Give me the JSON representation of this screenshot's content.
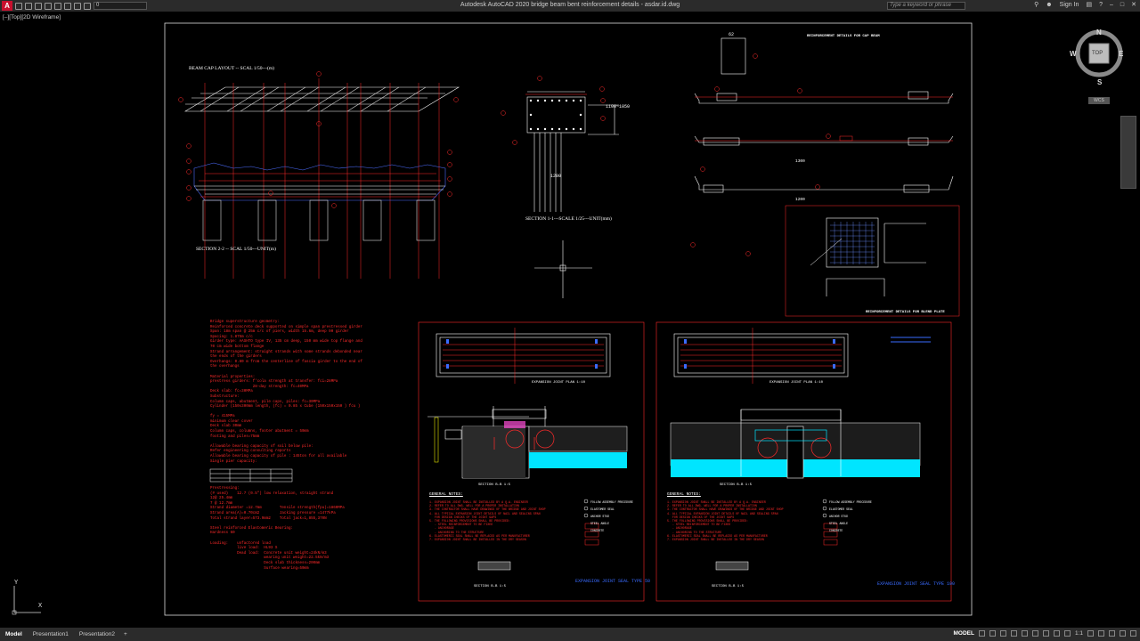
{
  "app": {
    "title": "Autodesk AutoCAD 2020   bridge beam bent reinforcement details - asdar.id.dwg",
    "layer_value": "0",
    "search_placeholder": "Type a keyword or phrase",
    "sign_in": "Sign In",
    "viewport_label": "[–][Top][2D Wireframe]"
  },
  "viewcube": {
    "north": "N",
    "south": "S",
    "east": "E",
    "west": "W",
    "face": "TOP",
    "wcs": "WCS"
  },
  "ucs": {
    "x_label": "X",
    "y_label": "Y"
  },
  "drawing": {
    "beam_cap_title": "BEAM CAP LAYOUT -- SCAL 1/50---(m)",
    "section22_title": "SECTION 2-2 -- SCAL 1/50---UNIT(m)",
    "section11_title": "SECTION 1-1---SCALE 1/25---UNIT(mm)",
    "section11_dim1": "1100~1050",
    "section11_dim2": "1200",
    "reinf_title_top": "REINFORCEMENT DETAILS FOR CAP BEAM",
    "reinf_title_bottom": "REINFORCEMENT DETAILS FOR BLEND PLATE",
    "top_dim": "62",
    "notes_left": [
      "Bridge superstructure geometry:",
      "Reinforced concrete deck supported on simple span prestressed girder",
      "Span: 18m span @ 25m c/c of piers, width 15.6m, deep 90 girder",
      "Spacing: 1.875m c/c",
      "Girder type: AASHTO type IV, 135 cm deep, 150 mm wide top flange and",
      "70 cm wide bottom flange",
      "Strand arrangement: straight strands with some strands debonded near",
      "the ends of the girders",
      "Overhangs: 0.80 m from the centerline of fascia girder to the end of",
      "the overhangs",
      "",
      "Material properties:",
      "prestress girders: f'cola strength at transfer: fci=28MPa",
      "                   28-day strength: fc=40MPa",
      "Deck slab: fc=30MPa",
      "Substructure:",
      "Column caps, abutment, pile caps, piles: fc=30MPa",
      "Cylinder (150x300mm length, (fc) = 0.85 x Cube (150x150x150 ) fcu )",
      "",
      "fy = 415MPa",
      "minimum clear cover",
      "Deck slab 30mm",
      "Column caps, columns, footer abutment = 50mm",
      "footing and piles=75mm",
      "",
      "Allowable bearing capacity of soil below pile:",
      "Refer engineering consulting reports",
      "Allowable bearing capacity of pile : 145ton for all available",
      "Single pier capacity:"
    ],
    "notes_left_2": [
      "Prestressing:",
      "(# used)    12.7 (0.5\") low relaxation, straight strand",
      "12@ 25.4mm",
      "7 @ 12.7mm",
      "Strand diameter =12.7mm        Tensile strength(fpu)=1860MPa",
      "Strand area(A)=0.70cm2         Jacking pressure =1477kPa",
      "Total strand layer=573.9mm2    Total jack=1,855,370N",
      "",
      "Steel reinforced Elastomeric Bearing:",
      "Hardness 60",
      "",
      "Loading:    unfactored load",
      "            live load:  HL93 S",
      "            Dead load:  Concrete unit weight=24kN/m3",
      "                        wearing unit weight=22.5kN/m3",
      "                        Deck slab thickness=200mm",
      "                        Surface wearing=50mm"
    ],
    "exp_plan_label": "EXPANSION JOINT PLAN  1:10",
    "section_label": "SECTION B-B  1:5",
    "general_notes": "GENERAL NOTES:",
    "gn_lines": [
      "1. EXPANSION JOINT SHALL BE INSTALLED BY A Q.A. ENGINEER",
      "2. REFER TO ALL DWG. WELL FOR A PROPER INSTALLATION",
      "3. THE CONTRACTOR SHALL HAVE DRAWINGS OF THE BRIDGE AND JOINT SHOP",
      "4. ALL TYPICAL EXPANSION JOINT DETAILS OF NAIL AND SEALING SPAN",
      "   FOR DESIGN CHECKS OF THE JOINT GAPS",
      "5. THE FOLLOWING PROVISIONS SHALL BE PROVIDED:",
      "   - STEEL REINFORCEMENT TO BE FIXED",
      "   - ANCHORAGE",
      "   - ANCHORING TO THE STRUCTURE",
      "6. ELASTOMERIC SEAL SHALL BE REPLACED AS PER MANUFACTURER",
      "7. EXPANSION JOINT SHALL BE INSTALLED IN THE DRY SEASON"
    ],
    "legend_items": [
      "FOLLOW ASSEMBLY PROCEDURE",
      "ELASTOMER SEAL",
      "ANCHOR STUD",
      "STEEL ANGLE",
      "CONCRETE"
    ],
    "exp_joint_left": "EXPANSION JOINT SEAL TYPE 50",
    "exp_joint_right": "EXPANSION JOINT SEAL TYPE 100",
    "dim_1300": "1300",
    "dim_1200b": "1200"
  },
  "statusbar": {
    "tabs": [
      "Model",
      "Presentation1",
      "Presentation2"
    ],
    "add_tab": "+",
    "model_label": "MODEL",
    "scale": "1:1"
  },
  "colors": {
    "background": "#000000",
    "red": "#ff2a2a",
    "white": "#ffffff",
    "cyan": "#00e5ff",
    "blue": "#3a6bff",
    "magenta": "#ff4fd8",
    "yellow": "#e6e600",
    "chrome": "#2b2b2b"
  }
}
